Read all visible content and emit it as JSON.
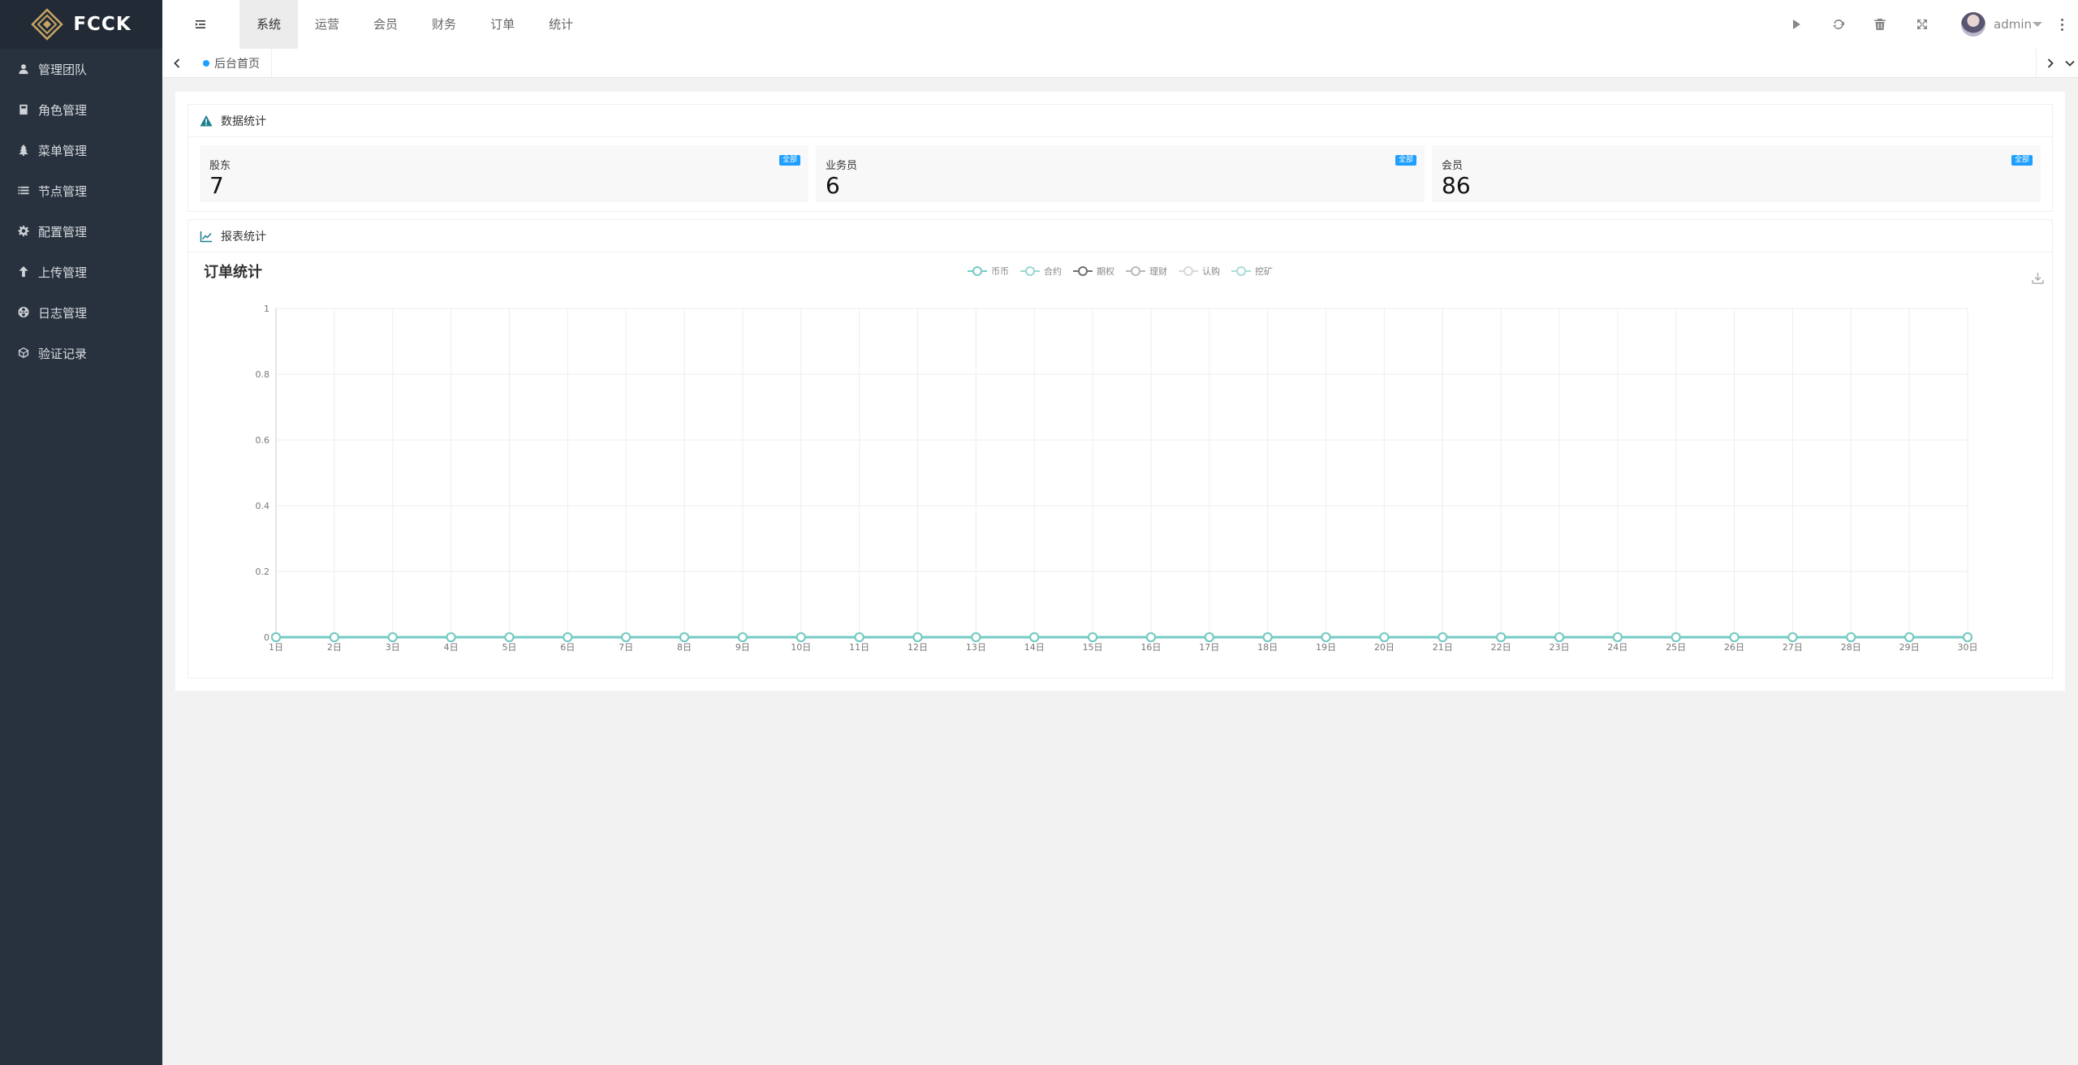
{
  "app": {
    "logo_text": "FCCK"
  },
  "sidebar": {
    "items": [
      {
        "label": "管理团队",
        "icon": "user-icon"
      },
      {
        "label": "角色管理",
        "icon": "role-icon"
      },
      {
        "label": "菜单管理",
        "icon": "tree-icon"
      },
      {
        "label": "节点管理",
        "icon": "list-icon"
      },
      {
        "label": "配置管理",
        "icon": "gear-icon"
      },
      {
        "label": "上传管理",
        "icon": "upload-icon"
      },
      {
        "label": "日志管理",
        "icon": "globe-icon"
      },
      {
        "label": "验证记录",
        "icon": "cube-icon"
      }
    ]
  },
  "header": {
    "tabs": [
      "系统",
      "运营",
      "会员",
      "财务",
      "订单",
      "统计"
    ],
    "active_tab": 0,
    "user": "admin"
  },
  "tabbar": {
    "current": "后台首页"
  },
  "data_panel": {
    "title": "数据统计",
    "stats": [
      {
        "label": "股东",
        "value": "7",
        "badge": "全部"
      },
      {
        "label": "业务员",
        "value": "6",
        "badge": "全部"
      },
      {
        "label": "会员",
        "value": "86",
        "badge": "全部"
      }
    ]
  },
  "report_panel": {
    "title": "报表统计"
  },
  "chart_data": {
    "type": "line",
    "title": "订单统计",
    "categories": [
      "1日",
      "2日",
      "3日",
      "4日",
      "5日",
      "6日",
      "7日",
      "8日",
      "9日",
      "10日",
      "11日",
      "12日",
      "13日",
      "14日",
      "15日",
      "16日",
      "17日",
      "18日",
      "19日",
      "20日",
      "21日",
      "22日",
      "23日",
      "24日",
      "25日",
      "26日",
      "27日",
      "28日",
      "29日",
      "30日"
    ],
    "series": [
      {
        "name": "币币",
        "values": [
          0,
          0,
          0,
          0,
          0,
          0,
          0,
          0,
          0,
          0,
          0,
          0,
          0,
          0,
          0,
          0,
          0,
          0,
          0,
          0,
          0,
          0,
          0,
          0,
          0,
          0,
          0,
          0,
          0,
          0
        ],
        "color": "#74cbc4"
      },
      {
        "name": "合约",
        "values": [
          0,
          0,
          0,
          0,
          0,
          0,
          0,
          0,
          0,
          0,
          0,
          0,
          0,
          0,
          0,
          0,
          0,
          0,
          0,
          0,
          0,
          0,
          0,
          0,
          0,
          0,
          0,
          0,
          0,
          0
        ],
        "color": "#97d7d5"
      },
      {
        "name": "期权",
        "values": [
          0,
          0,
          0,
          0,
          0,
          0,
          0,
          0,
          0,
          0,
          0,
          0,
          0,
          0,
          0,
          0,
          0,
          0,
          0,
          0,
          0,
          0,
          0,
          0,
          0,
          0,
          0,
          0,
          0,
          0
        ],
        "color": "#6e7074"
      },
      {
        "name": "理财",
        "values": [
          0,
          0,
          0,
          0,
          0,
          0,
          0,
          0,
          0,
          0,
          0,
          0,
          0,
          0,
          0,
          0,
          0,
          0,
          0,
          0,
          0,
          0,
          0,
          0,
          0,
          0,
          0,
          0,
          0,
          0
        ],
        "color": "#b8b8b8"
      },
      {
        "name": "认购",
        "values": [
          0,
          0,
          0,
          0,
          0,
          0,
          0,
          0,
          0,
          0,
          0,
          0,
          0,
          0,
          0,
          0,
          0,
          0,
          0,
          0,
          0,
          0,
          0,
          0,
          0,
          0,
          0,
          0,
          0,
          0
        ],
        "color": "#d8d8d8"
      },
      {
        "name": "挖矿",
        "values": [
          0,
          0,
          0,
          0,
          0,
          0,
          0,
          0,
          0,
          0,
          0,
          0,
          0,
          0,
          0,
          0,
          0,
          0,
          0,
          0,
          0,
          0,
          0,
          0,
          0,
          0,
          0,
          0,
          0,
          0
        ],
        "color": "#a9ddd6"
      }
    ],
    "yticks": [
      "0",
      "0.2",
      "0.4",
      "0.6",
      "0.8",
      "1"
    ],
    "ylim": [
      0,
      1
    ],
    "grid": true,
    "legend": "top-center"
  }
}
